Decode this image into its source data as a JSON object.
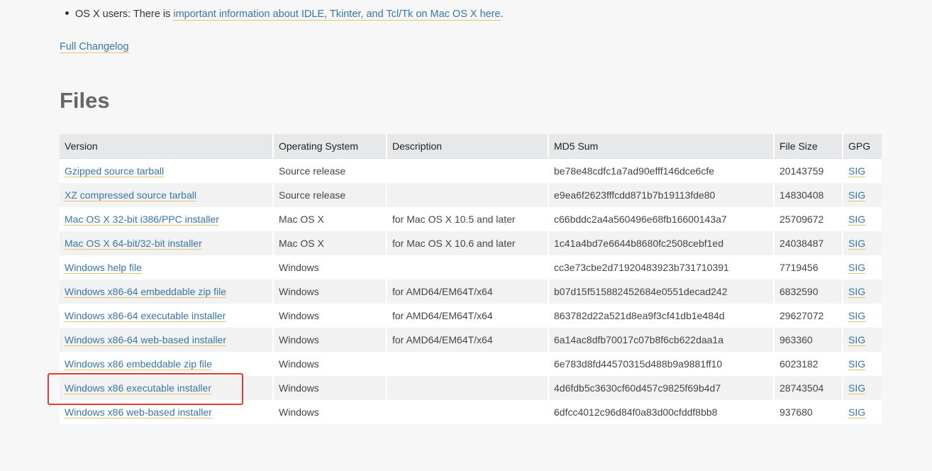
{
  "notes": {
    "os_x_prefix": "OS X users: There is ",
    "os_x_link": "important information about IDLE, Tkinter, and Tcl/Tk on Mac OS X here",
    "os_x_suffix": "."
  },
  "changelog_link": "Full Changelog",
  "files_title": "Files",
  "table": {
    "headers": [
      "Version",
      "Operating System",
      "Description",
      "MD5 Sum",
      "File Size",
      "GPG"
    ],
    "rows": [
      {
        "version": "Gzipped source tarball",
        "os": "Source release",
        "description": "",
        "md5": "be78e48cdfc1a7ad90efff146dce6cfe",
        "size": "20143759",
        "gpg": "SIG"
      },
      {
        "version": "XZ compressed source tarball",
        "os": "Source release",
        "description": "",
        "md5": "e9ea6f2623fffcdd871b7b19113fde80",
        "size": "14830408",
        "gpg": "SIG"
      },
      {
        "version": "Mac OS X 32-bit i386/PPC installer",
        "os": "Mac OS X",
        "description": "for Mac OS X 10.5 and later",
        "md5": "c66bddc2a4a560496e68fb16600143a7",
        "size": "25709672",
        "gpg": "SIG"
      },
      {
        "version": "Mac OS X 64-bit/32-bit installer",
        "os": "Mac OS X",
        "description": "for Mac OS X 10.6 and later",
        "md5": "1c41a4bd7e6644b8680fc2508cebf1ed",
        "size": "24038487",
        "gpg": "SIG"
      },
      {
        "version": "Windows help file",
        "os": "Windows",
        "description": "",
        "md5": "cc3e73cbe2d71920483923b731710391",
        "size": "7719456",
        "gpg": "SIG"
      },
      {
        "version": "Windows x86-64 embeddable zip file",
        "os": "Windows",
        "description": "for AMD64/EM64T/x64",
        "md5": "b07d15f515882452684e0551decad242",
        "size": "6832590",
        "gpg": "SIG"
      },
      {
        "version": "Windows x86-64 executable installer",
        "os": "Windows",
        "description": "for AMD64/EM64T/x64",
        "md5": "863782d22a521d8ea9f3cf41db1e484d",
        "size": "29627072",
        "gpg": "SIG"
      },
      {
        "version": "Windows x86-64 web-based installer",
        "os": "Windows",
        "description": "for AMD64/EM64T/x64",
        "md5": "6a14ac8dfb70017c07b8f6cb622daa1a",
        "size": "963360",
        "gpg": "SIG"
      },
      {
        "version": "Windows x86 embeddable zip file",
        "os": "Windows",
        "description": "",
        "md5": "6e783d8fd44570315d488b9a9881ff10",
        "size": "6023182",
        "gpg": "SIG"
      },
      {
        "version": "Windows x86 executable installer",
        "os": "Windows",
        "description": "",
        "md5": "4d6fdb5c3630cf60d457c9825f69b4d7",
        "size": "28743504",
        "gpg": "SIG"
      },
      {
        "version": "Windows x86 web-based installer",
        "os": "Windows",
        "description": "",
        "md5": "6dfcc4012c96d84f0a83d00cfddf8bb8",
        "size": "937680",
        "gpg": "SIG"
      }
    ]
  },
  "highlighted_row": "Windows x86 executable installer",
  "colors": {
    "link": "#3776ab",
    "link_underline": "#e3c56b",
    "highlight": "#e53935",
    "header_bg": "#e6e8ea"
  }
}
